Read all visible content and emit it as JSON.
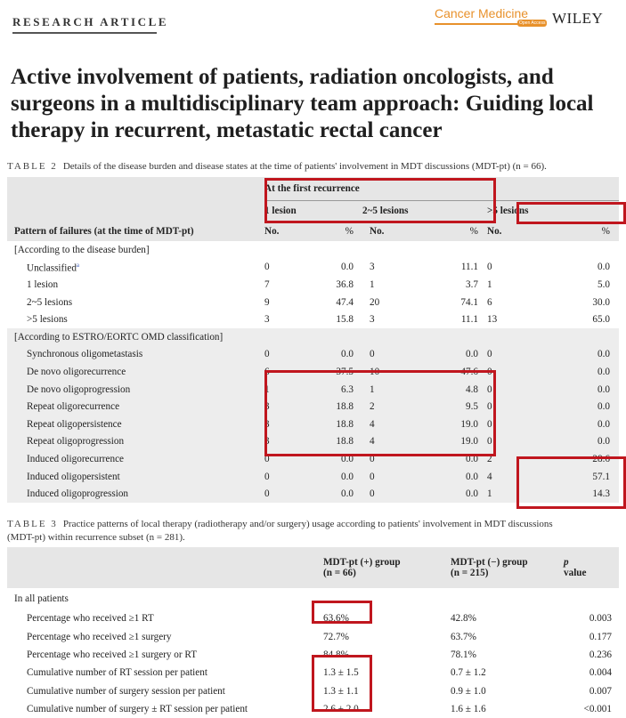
{
  "header": {
    "section_label": "RESEARCH ARTICLE",
    "journal": "Cancer Medicine",
    "journal_badge": "Open Access",
    "publisher": "WILEY"
  },
  "title": "Active involvement of patients, radiation oncologists, and surgeons in a multidisciplinary team approach: Guiding local therapy in recurrent, metastatic rectal cancer",
  "colors": {
    "highlight": "#c0161e",
    "journal": "#e8912b",
    "table_header_bg": "#e6e6e6"
  },
  "table2": {
    "label": "TABLE 2",
    "caption": "Details of the disease burden and disease states at the time of patients' involvement in MDT discussions (MDT-pt) (n = 66).",
    "group_header": "At the first recurrence",
    "col_groups": [
      "1 lesion",
      "2~5 lesions",
      ">5 lesions"
    ],
    "row_header": "Pattern of failures (at the time of MDT-pt)",
    "sub_cols": [
      "No.",
      "%",
      "No.",
      "%",
      "No.",
      "%"
    ],
    "sections": [
      {
        "label": "[According to the disease burden]",
        "rows": [
          {
            "label": "Unclassified",
            "sup": "a",
            "values": [
              "0",
              "0.0",
              "3",
              "11.1",
              "0",
              "0.0"
            ]
          },
          {
            "label": "1 lesion",
            "values": [
              "7",
              "36.8",
              "1",
              "3.7",
              "1",
              "5.0"
            ]
          },
          {
            "label": "2~5 lesions",
            "values": [
              "9",
              "47.4",
              "20",
              "74.1",
              "6",
              "30.0"
            ]
          },
          {
            "label": ">5 lesions",
            "values": [
              "3",
              "15.8",
              "3",
              "11.1",
              "13",
              "65.0"
            ]
          }
        ]
      },
      {
        "label": "[According to ESTRO/EORTC OMD classification]",
        "rows": [
          {
            "label": "Synchronous oligometastasis",
            "values": [
              "0",
              "0.0",
              "0",
              "0.0",
              "0",
              "0.0"
            ]
          },
          {
            "label": "De novo oligorecurrence",
            "values": [
              "6",
              "37.5",
              "10",
              "47.6",
              "0",
              "0.0"
            ]
          },
          {
            "label": "De novo oligoprogression",
            "values": [
              "1",
              "6.3",
              "1",
              "4.8",
              "0",
              "0.0"
            ]
          },
          {
            "label": "Repeat oligorecurrence",
            "values": [
              "3",
              "18.8",
              "2",
              "9.5",
              "0",
              "0.0"
            ]
          },
          {
            "label": "Repeat oligopersistence",
            "values": [
              "3",
              "18.8",
              "4",
              "19.0",
              "0",
              "0.0"
            ]
          },
          {
            "label": "Repeat oligoprogression",
            "values": [
              "3",
              "18.8",
              "4",
              "19.0",
              "0",
              "0.0"
            ]
          },
          {
            "label": "Induced oligorecurrence",
            "values": [
              "0",
              "0.0",
              "0",
              "0.0",
              "2",
              "28.6"
            ]
          },
          {
            "label": "Induced oligopersistent",
            "values": [
              "0",
              "0.0",
              "0",
              "0.0",
              "4",
              "57.1"
            ]
          },
          {
            "label": "Induced oligoprogression",
            "values": [
              "0",
              "0.0",
              "0",
              "0.0",
              "1",
              "14.3"
            ]
          }
        ]
      }
    ]
  },
  "table3": {
    "label": "TABLE 3",
    "caption_line1": "Practice patterns of local therapy (radiotherapy and/or surgery) usage according to patients' involvement in MDT discussions",
    "caption_line2": "(MDT-pt) within recurrence subset (n = 281).",
    "columns": [
      {
        "line1": "MDT-pt (+) group",
        "line2": "(n = 66)"
      },
      {
        "line1": "MDT-pt (−) group",
        "line2": "(n = 215)"
      },
      {
        "line1": "p",
        "line2": "value"
      }
    ],
    "section": "In all patients",
    "rows": [
      {
        "label": "Percentage who received ≥1 RT",
        "values": [
          "63.6%",
          "42.8%",
          "0.003"
        ]
      },
      {
        "label": "Percentage who received ≥1 surgery",
        "values": [
          "72.7%",
          "63.7%",
          "0.177"
        ]
      },
      {
        "label": "Percentage who received ≥1 surgery or RT",
        "values": [
          "84.8%",
          "78.1%",
          "0.236"
        ]
      },
      {
        "label": "Cumulative number of RT session per patient",
        "values": [
          "1.3 ± 1.5",
          "0.7 ± 1.2",
          "0.004"
        ]
      },
      {
        "label": "Cumulative number of surgery session per patient",
        "values": [
          "1.3 ± 1.1",
          "0.9 ± 1.0",
          "0.007"
        ]
      },
      {
        "label": "Cumulative number of surgery ± RT session per patient",
        "values": [
          "2.6 ± 2.0",
          "1.6 ± 1.6",
          "<0.001"
        ]
      }
    ]
  }
}
